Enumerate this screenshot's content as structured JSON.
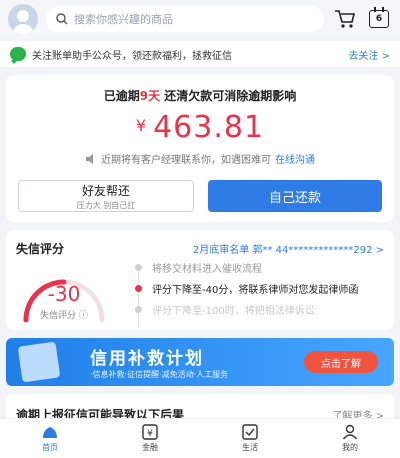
{
  "topbar": {
    "search_placeholder": "搜索你感兴趣的商品",
    "calendar_day": "6"
  },
  "notice": {
    "text": "关注账单助手公众号，领还款福利，拯救征信",
    "link": "去关注 >"
  },
  "overdue": {
    "title_prefix": "已逾期",
    "days": "9天",
    "title_suffix": " 还清欠款可消除逾期影响",
    "currency": "¥",
    "amount": "463.81",
    "hint": "近期将有客户经理联系你，如遇困难可",
    "hint_link": "在线沟通",
    "friend_button": "好友帮还",
    "friend_sub": "压力大 别自己扛",
    "self_button": "自己还款"
  },
  "credit": {
    "title": "失信评分",
    "blacklist": "2月底审名单 郭** 44*************292 >",
    "score": "-30",
    "score_label": "失信评分",
    "timeline": [
      "将移交材料进入催收流程",
      "评分下降至-40分，将联系律师对您发起律师函",
      "评分下降至-100时，将把相法律诉讼"
    ]
  },
  "banner": {
    "title": "信用补救计划",
    "sub": "·信息补救·征信提醒·减免活动·人工服务",
    "button": "点击了解"
  },
  "consequences": {
    "title": "逾期上报征信可能导致以下后果",
    "more": "了解更多 >"
  },
  "tabs": [
    {
      "label": "首页",
      "icon": "home-icon"
    },
    {
      "label": "金融",
      "icon": "finance-icon"
    },
    {
      "label": "生活",
      "icon": "life-icon"
    },
    {
      "label": "我的",
      "icon": "profile-icon"
    }
  ],
  "colors": {
    "accent": "#2f7ce6",
    "danger": "#e8334a"
  }
}
